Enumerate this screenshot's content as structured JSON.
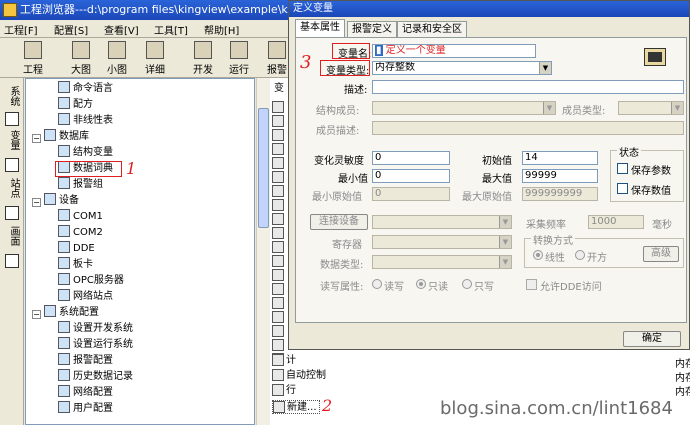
{
  "window": {
    "title": "工程浏览器---d:\\program files\\kingview\\example\\kingd"
  },
  "menu": [
    "工程[F]",
    "配置[S]",
    "查看[V]",
    "工具[T]",
    "帮助[H]"
  ],
  "toolbar": [
    "工程",
    "大图",
    "小图",
    "详细",
    "开发",
    "运行",
    "报警"
  ],
  "vtabs": [
    "系统",
    "变量",
    "站点",
    "画面"
  ],
  "tree": [
    {
      "label": "命令语言",
      "depth": 2
    },
    {
      "label": "配方",
      "depth": 2
    },
    {
      "label": "非线性表",
      "depth": 2
    },
    {
      "label": "数据库",
      "depth": 1
    },
    {
      "label": "结构变量",
      "depth": 2
    },
    {
      "label": "数据词典",
      "depth": 2
    },
    {
      "label": "报警组",
      "depth": 2
    },
    {
      "label": "设备",
      "depth": 1
    },
    {
      "label": "COM1",
      "depth": 2
    },
    {
      "label": "COM2",
      "depth": 2
    },
    {
      "label": "DDE",
      "depth": 2
    },
    {
      "label": "板卡",
      "depth": 2
    },
    {
      "label": "OPC服务器",
      "depth": 2
    },
    {
      "label": "网络站点",
      "depth": 2
    },
    {
      "label": "系统配置",
      "depth": 1
    },
    {
      "label": "设置开发系统",
      "depth": 2
    },
    {
      "label": "设置运行系统",
      "depth": 2
    },
    {
      "label": "报警配置",
      "depth": 2
    },
    {
      "label": "历史数据记录",
      "depth": 2
    },
    {
      "label": "网络配置",
      "depth": 2
    },
    {
      "label": "用户配置",
      "depth": 2
    }
  ],
  "list": {
    "header": "变",
    "bottom_items": [
      "计",
      "自动控制",
      "行",
      "新建..."
    ],
    "right_col": [
      "内存",
      "内存",
      "内存"
    ]
  },
  "dialog": {
    "title": "定义变量",
    "tabs": [
      "基本属性",
      "报警定义",
      "记录和安全区"
    ],
    "fields": {
      "var_name_label": "变量名:",
      "var_name_value": "定义一个变量",
      "var_type_label": "变量类型:",
      "var_type_value": "内存整数",
      "desc_label": "描述:",
      "desc_value": "",
      "struct_member_label": "结构成员:",
      "member_type_label": "成员类型:",
      "member_desc_label": "成员描述:",
      "change_sens_label": "变化灵敏度",
      "change_sens_value": "0",
      "init_label": "初始值",
      "init_value": "14",
      "min_label": "最小值",
      "min_value": "0",
      "max_label": "最大值",
      "max_value": "99999",
      "min_raw_label": "最小原始值",
      "min_raw_value": "0",
      "max_raw_label": "最大原始值",
      "max_raw_value": "999999999",
      "device_label": "连接设备",
      "register_label": "寄存器",
      "datatype_label": "数据类型:",
      "rw_label": "读写属性:",
      "rw_options": [
        "读写",
        "只读",
        "只写"
      ],
      "rw_selected": "只读",
      "sample_label": "采集频率",
      "sample_value": "1000",
      "sample_unit": "毫秒",
      "convert_label": "转换方式",
      "convert_options": [
        "线性",
        "开方"
      ],
      "advanced_button": "高级",
      "allow_dde": "允许DDE访问",
      "status_label": "状态",
      "save_param": "保存参数",
      "save_value": "保存数值",
      "ok_button": "确定"
    }
  },
  "annotations": {
    "one": "1",
    "two": "2",
    "three": "3"
  },
  "watermark": "blog.sina.com.cn/lint1684"
}
